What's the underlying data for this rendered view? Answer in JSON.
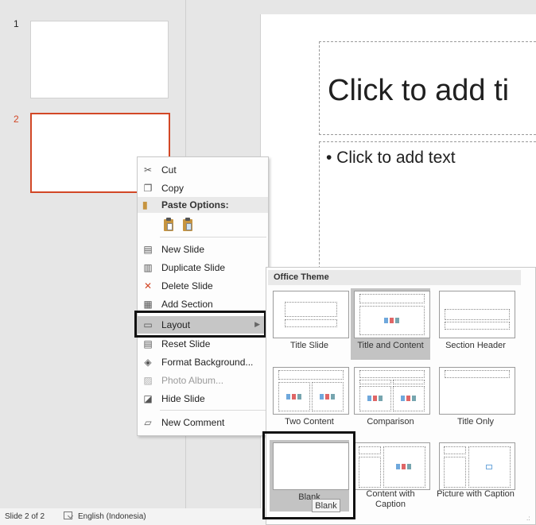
{
  "thumbnails": {
    "slide1_number": "1",
    "slide2_number": "2"
  },
  "slide": {
    "title_placeholder": "Click to add ti",
    "body_placeholder": "• Click to add text"
  },
  "status_bar": {
    "slide_info": "Slide 2 of 2",
    "language": "English (Indonesia)"
  },
  "context_menu": {
    "cut": "Cut",
    "copy": "Copy",
    "paste_options": "Paste Options:",
    "new_slide": "New Slide",
    "duplicate_slide": "Duplicate Slide",
    "delete_slide": "Delete Slide",
    "add_section": "Add Section",
    "layout": "Layout",
    "reset_slide": "Reset Slide",
    "format_background": "Format Background...",
    "photo_album": "Photo Album...",
    "hide_slide": "Hide Slide",
    "new_comment": "New Comment"
  },
  "layout_menu": {
    "header": "Office Theme",
    "layouts": [
      "Title Slide",
      "Title and Content",
      "Section Header",
      "Two Content",
      "Comparison",
      "Title Only",
      "Blank",
      "Content with Caption",
      "Picture with Caption"
    ],
    "selected": "Title and Content",
    "hovered": "Blank",
    "tooltip": "Blank"
  },
  "colors": {
    "selected_thumbnail_border": "#d24726",
    "menu_hover": "#c6c6c6"
  }
}
